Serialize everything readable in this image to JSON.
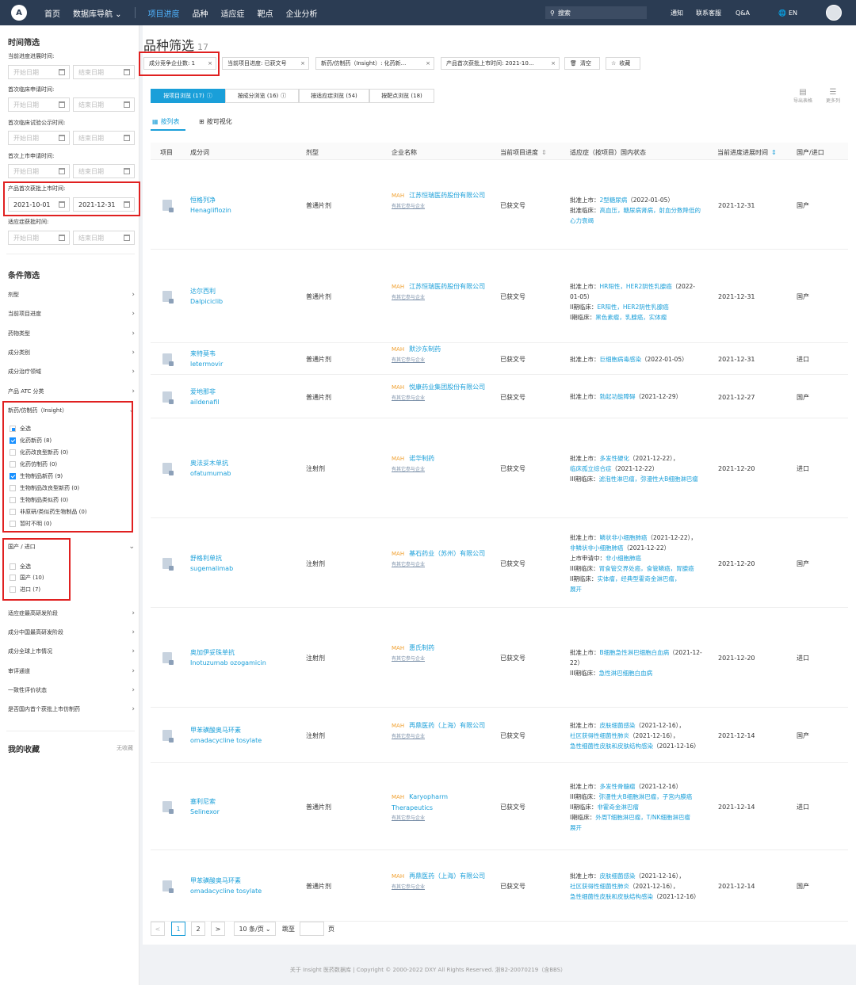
{
  "topbar": {
    "logo": "A",
    "nav": [
      "首页",
      "数据库导航 ⌄",
      "项目进度",
      "品种",
      "适应症",
      "靶点",
      "企业分析"
    ],
    "search_placeholder": "搜索",
    "right": [
      "通知",
      "联系客服",
      "Q&A",
      "EN"
    ]
  },
  "sidebar": {
    "time_title": "时间筛选",
    "date_filters": [
      {
        "label": "当前进度进展时间:",
        "start": "开始日期",
        "end": "结束日期"
      },
      {
        "label": "首次临床申请时间:",
        "start": "开始日期",
        "end": "结束日期"
      },
      {
        "label": "首次临床试验公示时间:",
        "start": "开始日期",
        "end": "结束日期"
      },
      {
        "label": "首次上市申请时间:",
        "start": "开始日期",
        "end": "结束日期"
      },
      {
        "label": "产品首次获批上市时间:",
        "start": "2021-10-01",
        "end": "2021-12-31"
      },
      {
        "label": "适应症获批时间:",
        "start": "开始日期",
        "end": "结束日期"
      }
    ],
    "cond_title": "条件筛选",
    "cond_items": [
      "剂型",
      "当前项目进度",
      "药物类型",
      "成分类别",
      "成分治疗领域",
      "产品 ATC 分类"
    ],
    "insight_title": "新药/仿制药（Insight）",
    "insight_opts": [
      "全选",
      "化药新药 (8)",
      "化药改良型新药 (0)",
      "化药仿制药 (0)",
      "生物制品新药 (9)",
      "生物制品改良型新药 (0)",
      "生物制品类似药 (0)",
      "非原研/类似药生物制品 (0)",
      "暂时不明 (0)"
    ],
    "origin_title": "国产 / 进口",
    "origin_opts": [
      "全选",
      "国产 (10)",
      "进口 (7)"
    ],
    "more_items": [
      "适应症最高研发阶段",
      "成分中国最高研发阶段",
      "成分全球上市情况",
      "审评通道",
      "一致性评价状态",
      "是否国内首个获批上市仿制药"
    ],
    "fav_title": "我的收藏",
    "fav_empty": "无收藏"
  },
  "main": {
    "title": "品种筛选",
    "count": "17",
    "tags": [
      "成分竞争企业数: 1",
      "当前项目进度: 已获文号",
      "新药/仿制药（Insight）: 化药新...",
      "产品首次获批上市时间: 2021-10...",
      "清空",
      "收藏"
    ],
    "view_tabs": [
      "按项目浏览 (17)",
      "按成分浏览 (16)",
      "按适应症浏览 (54)",
      "按靶点浏览 (18)"
    ],
    "tools": [
      "导出表格",
      "更多列"
    ],
    "subtabs": [
      "按列表",
      "按可视化"
    ],
    "columns": [
      "项目",
      "成分词",
      "剂型",
      "企业名称",
      "当前项目进度",
      "适应症（按项目）国内状态",
      "当前进度进展时间",
      "国产/进口"
    ],
    "mah": "MAH",
    "more_company": "有其它参与企业",
    "expand": "展开",
    "rows": [
      {
        "cn": "恒格列净",
        "en": "Henagliflozin",
        "form": "普通片剂",
        "company": "江苏恒瑞医药股份有限公司",
        "status": "已获文号",
        "ind": [
          [
            "批准上市：",
            "2型糖尿病",
            "（2022-01-05）"
          ],
          [
            "批准临床：",
            "高血压，糖尿病肾病，射血分数降低的心力衰竭",
            ""
          ]
        ],
        "date": "2021-12-31",
        "origin": "国产",
        "more": true
      },
      {
        "cn": "达尔西利",
        "en": "Dalpiciclib",
        "form": "普通片剂",
        "company": "江苏恒瑞医药股份有限公司",
        "status": "已获文号",
        "ind": [
          [
            "批准上市：",
            "HR阳性，HER2阴性乳腺癌",
            "（2022-01-05）"
          ],
          [
            "II期临床：",
            "ER阳性，HER2阴性乳腺癌",
            ""
          ],
          [
            "I期临床：",
            "黑色素瘤，乳腺癌，实体瘤",
            ""
          ]
        ],
        "date": "2021-12-31",
        "origin": "国产",
        "more": true
      },
      {
        "cn": "来特莫韦",
        "en": "letermovir",
        "form": "普通片剂",
        "company": "默沙东制药",
        "status": "已获文号",
        "ind": [
          [
            "批准上市：",
            "巨细胞病毒感染",
            "（2022-01-05）"
          ]
        ],
        "date": "2021-12-31",
        "origin": "进口",
        "more": true
      },
      {
        "cn": "爱地那非",
        "en": "aildenafil",
        "form": "普通片剂",
        "company": "悦康药业集团股份有限公司",
        "status": "已获文号",
        "ind": [
          [
            "批准上市：",
            "勃起功能障碍",
            "（2021-12-29）"
          ]
        ],
        "date": "2021-12-27",
        "origin": "国产",
        "more": true
      },
      {
        "cn": "奥法妥木单抗",
        "en": "ofatumumab",
        "form": "注射剂",
        "company": "诺华制药",
        "status": "已获文号",
        "ind": [
          [
            "批准上市：",
            "多发性硬化",
            "（2021-12-22），"
          ],
          [
            "",
            "临床孤立综合症",
            "（2021-12-22）"
          ],
          [
            "III期临床：",
            "滤泡性淋巴瘤，弥漫性大B细胞淋巴瘤",
            ""
          ]
        ],
        "date": "2021-12-20",
        "origin": "进口",
        "more": true
      },
      {
        "cn": "舒格利单抗",
        "en": "sugemalimab",
        "form": "注射剂",
        "company": "基石药业（苏州）有限公司",
        "status": "已获文号",
        "ind": [
          [
            "批准上市：",
            "鳞状非小细胞肺癌",
            "（2021-12-22），"
          ],
          [
            "",
            "非鳞状非小细胞肺癌",
            "（2021-12-22）"
          ],
          [
            "上市申请中：",
            "非小细胞肺癌",
            ""
          ],
          [
            "III期临床：",
            "胃食管交界处癌，食管鳞癌，胃腺癌",
            ""
          ],
          [
            "II期临床：",
            "实体瘤，经典型霍奇金淋巴瘤，",
            ""
          ]
        ],
        "date": "2021-12-20",
        "origin": "国产",
        "more": true,
        "expand": true
      },
      {
        "cn": "奥加伊妥珠单抗",
        "en": "Inotuzumab ozogamicin",
        "form": "注射剂",
        "company": "惠氏制药",
        "status": "已获文号",
        "ind": [
          [
            "批准上市：",
            "B细胞急性淋巴细胞白血病",
            "（2021-12-22）"
          ],
          [
            "III期临床：",
            "急性淋巴细胞白血病",
            ""
          ]
        ],
        "date": "2021-12-20",
        "origin": "进口",
        "more": true
      },
      {
        "cn": "甲苯磺酸奥马环素",
        "en": "omadacycline tosylate",
        "form": "注射剂",
        "company": "再鼎医药（上海）有限公司",
        "status": "已获文号",
        "ind": [
          [
            "批准上市：",
            "皮肤细菌感染",
            "（2021-12-16），"
          ],
          [
            "",
            "社区获得性细菌性肺炎",
            "（2021-12-16），"
          ],
          [
            "",
            "急性细菌性皮肤和皮肤结构感染",
            "（2021-12-16）"
          ]
        ],
        "date": "2021-12-14",
        "origin": "国产",
        "more": true
      },
      {
        "cn": "塞利尼索",
        "en": "Selinexor",
        "form": "普通片剂",
        "company": "Karyopharm Therapeutics",
        "status": "已获文号",
        "ind": [
          [
            "批准上市：",
            "多发性骨髓瘤",
            "（2021-12-16）"
          ],
          [
            "III期临床：",
            "弥漫性大B细胞淋巴瘤，子宫内膜癌",
            ""
          ],
          [
            "II期临床：",
            "非霍奇金淋巴瘤",
            ""
          ],
          [
            "I期临床：",
            "外周T细胞淋巴瘤，T/NK细胞淋巴瘤",
            ""
          ]
        ],
        "date": "2021-12-14",
        "origin": "进口",
        "more": true,
        "expand": true
      },
      {
        "cn": "甲苯磺酸奥马环素",
        "en": "omadacycline tosylate",
        "form": "普通片剂",
        "company": "再鼎医药（上海）有限公司",
        "status": "已获文号",
        "ind": [
          [
            "批准上市：",
            "皮肤细菌感染",
            "（2021-12-16），"
          ],
          [
            "",
            "社区获得性细菌性肺炎",
            "（2021-12-16），"
          ],
          [
            "",
            "急性细菌性皮肤和皮肤结构感染",
            "（2021-12-16）"
          ]
        ],
        "date": "2021-12-14",
        "origin": "国产",
        "more": true
      }
    ],
    "pager": {
      "prev": "<",
      "page1": "1",
      "page2": "2",
      "next": ">",
      "size": "10 条/页",
      "goto": "跳至",
      "page_unit": "页"
    }
  },
  "footer": "关于 Insight 医药数据库  |  Copyright © 2000-2022 DXY All Rights Reserved. 浙B2-20070219（含BBS）"
}
